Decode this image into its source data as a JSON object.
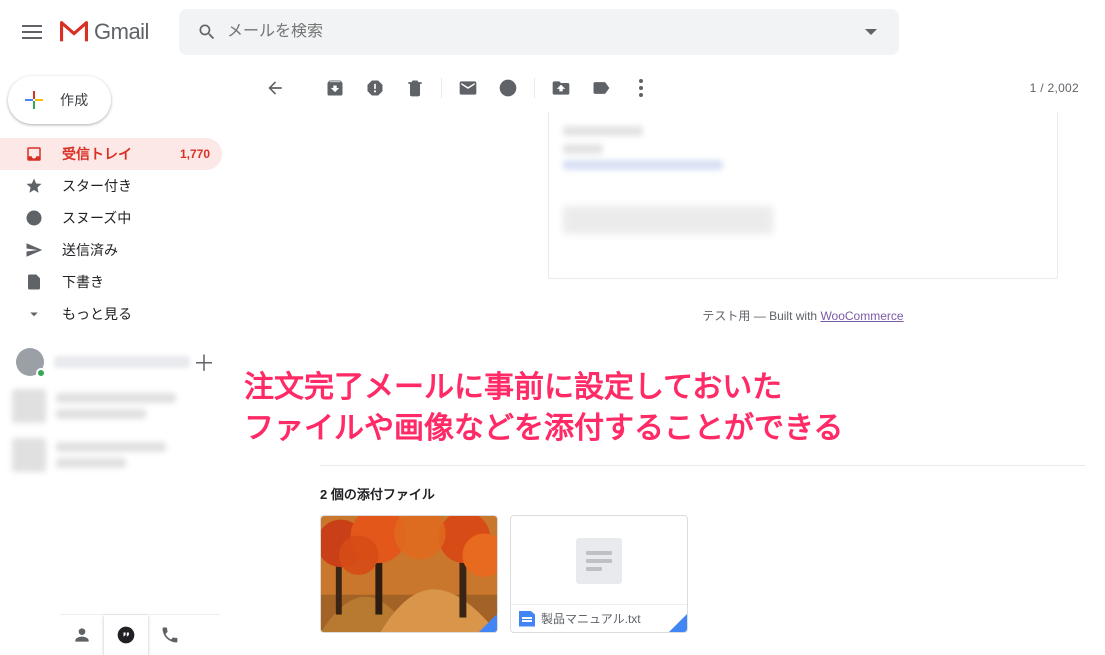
{
  "header": {
    "app_name": "Gmail",
    "search_placeholder": "メールを検索"
  },
  "compose_label": "作成",
  "nav": {
    "items": [
      {
        "label": "受信トレイ",
        "count": "1,770"
      },
      {
        "label": "スター付き"
      },
      {
        "label": "スヌーズ中"
      },
      {
        "label": "送信済み"
      },
      {
        "label": "下書き"
      },
      {
        "label": "もっと見る"
      }
    ]
  },
  "toolbar": {
    "position_text": "1 / 2,002"
  },
  "message": {
    "footer_prefix": "テスト用 — Built with ",
    "footer_link": "WooCommerce"
  },
  "overlay": {
    "line1": "注文完了メールに事前に設定しておいた",
    "line2": "ファイルや画像などを添付することができる"
  },
  "attachments": {
    "heading": "2 個の添付ファイル",
    "items": [
      {
        "filename": ""
      },
      {
        "filename": "製品マニュアル.txt"
      }
    ]
  }
}
